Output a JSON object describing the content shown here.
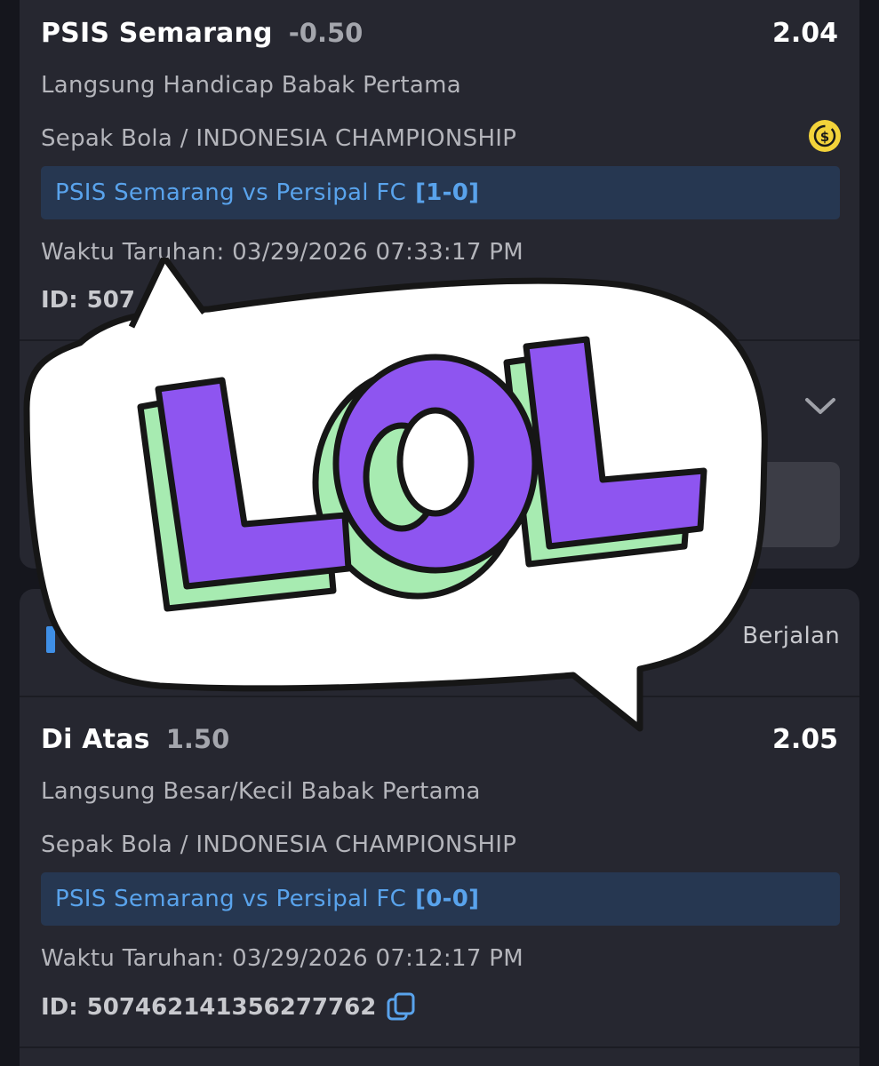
{
  "bet1": {
    "team": "PSIS Semarang",
    "handicap": "-0.50",
    "odds": "2.04",
    "market": "Langsung Handicap Babak Pertama",
    "league": "Sepak Bola / INDONESIA CHAMPIONSHIP",
    "match": "PSIS Semarang vs Persipal FC",
    "score": "[1-0]",
    "bet_time_label": "Waktu Taruhan:",
    "bet_time": "03/29/2026 07:33:17 PM",
    "id_label": "ID:",
    "id_value": "507"
  },
  "status": {
    "label": "Berjalan"
  },
  "bet2": {
    "team": "Di Atas",
    "handicap": "1.50",
    "odds": "2.05",
    "market": "Langsung Besar/Kecil Babak Pertama",
    "league": "Sepak Bola / INDONESIA CHAMPIONSHIP",
    "match": "PSIS Semarang vs Persipal FC",
    "score": "[0-0]",
    "bet_time_label": "Waktu Taruhan:",
    "bet_time": "03/29/2026 07:12:17 PM",
    "id_label": "ID:",
    "id_value": "507462141356277762"
  },
  "sticker": {
    "text": "LOL"
  },
  "colors": {
    "background": "#15161d",
    "card": "#262730",
    "match_box": "#263751",
    "link_blue": "#59a3ec",
    "coin_yellow": "#f3d33a",
    "sticker_purple": "#8e55f0",
    "sticker_green": "#a7ebb1"
  },
  "icons": [
    "coin-icon",
    "copy-icon",
    "chevron-down-icon",
    "speech-bubble-sticker"
  ]
}
